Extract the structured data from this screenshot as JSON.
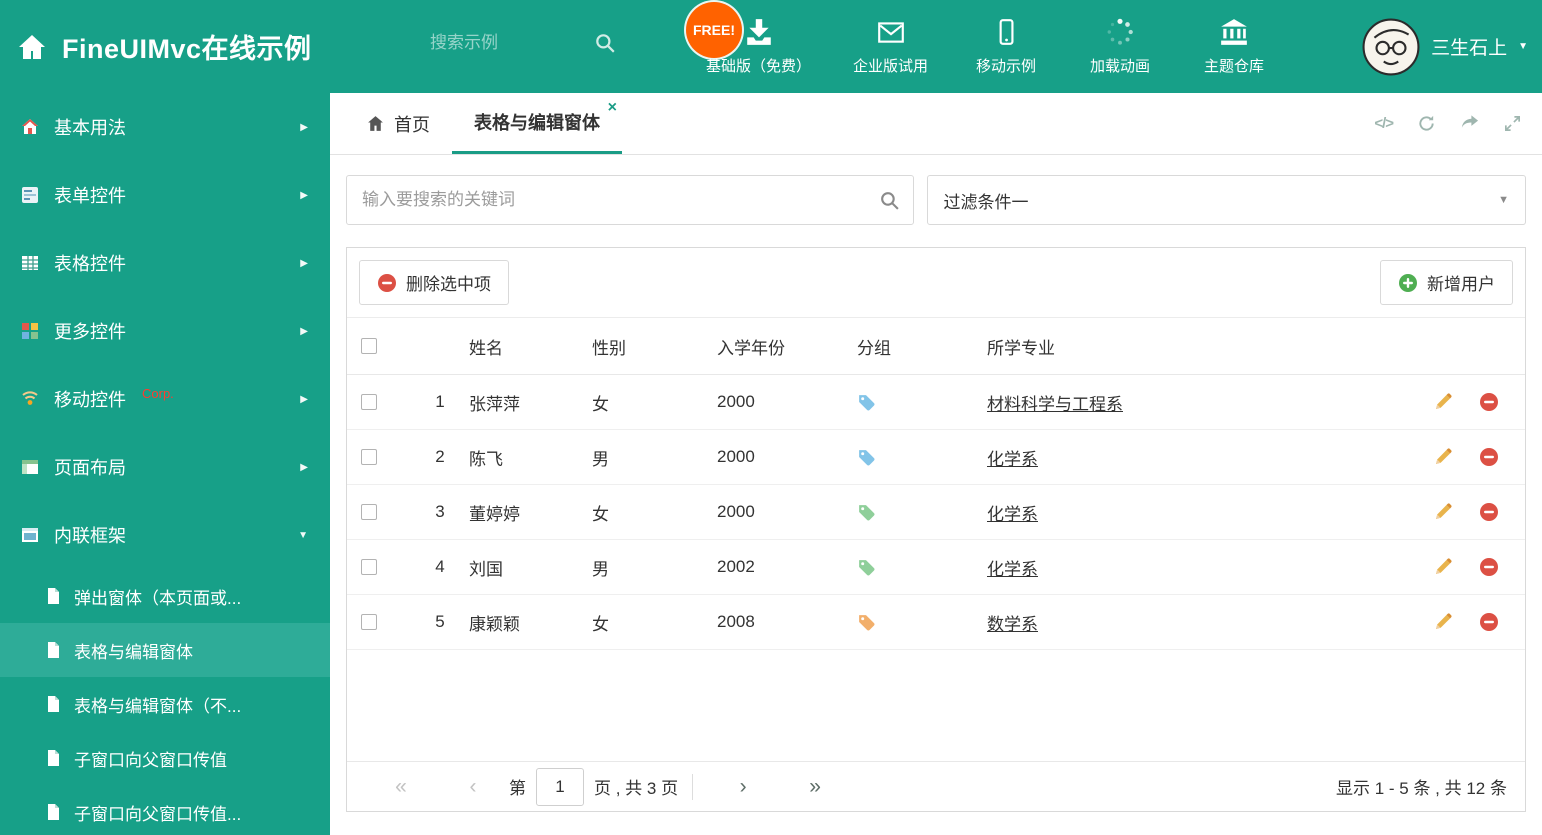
{
  "colors": {
    "theme_green": "#17A088",
    "selected_green": "#2EAC98",
    "accent": "#1A9C86",
    "free_badge": "#FF6200",
    "delete_red": "#DC5044",
    "add_green": "#4FAE52",
    "pencil_yellow": "#E9B44C",
    "link": "#333333",
    "corp_red": "#FF3B30"
  },
  "header": {
    "title": "FineUIMvc在线示例",
    "search_placeholder": "搜索示例",
    "free_badge": "FREE!",
    "nav": [
      {
        "label": "基础版（免费）",
        "icon": "download-icon"
      },
      {
        "label": "企业版试用",
        "icon": "envelope-icon"
      },
      {
        "label": "移动示例",
        "icon": "mobile-icon"
      },
      {
        "label": "加载动画",
        "icon": "spinner-icon"
      },
      {
        "label": "主题仓库",
        "icon": "bank-icon"
      }
    ],
    "user_name": "三生石上"
  },
  "sidebar": {
    "items": [
      {
        "label": "基本用法"
      },
      {
        "label": "表单控件"
      },
      {
        "label": "表格控件"
      },
      {
        "label": "更多控件"
      },
      {
        "label": "移动控件",
        "badge": "Corp."
      },
      {
        "label": "页面布局"
      },
      {
        "label": "内联框架"
      }
    ],
    "subitems": [
      {
        "label": "弹出窗体（本页面或..."
      },
      {
        "label": "表格与编辑窗体"
      },
      {
        "label": "表格与编辑窗体（不..."
      },
      {
        "label": "子窗口向父窗口传值"
      },
      {
        "label": "子窗口向父窗口传值..."
      }
    ]
  },
  "tabs": {
    "home": "首页",
    "active": "表格与编辑窗体"
  },
  "filter": {
    "search_placeholder": "输入要搜索的关键词",
    "dropdown_value": "过滤条件一"
  },
  "toolbar": {
    "delete_label": "删除选中项",
    "add_label": "新增用户"
  },
  "table": {
    "headers": {
      "name": "姓名",
      "gender": "性别",
      "year": "入学年份",
      "group": "分组",
      "major": "所学专业"
    },
    "rows": [
      {
        "index": "1",
        "name": "张萍萍",
        "gender": "女",
        "year": "2000",
        "tag_color": "#82C4E8",
        "major": "材料科学与工程系"
      },
      {
        "index": "2",
        "name": "陈飞",
        "gender": "男",
        "year": "2000",
        "tag_color": "#82C4E8",
        "major": "化学系"
      },
      {
        "index": "3",
        "name": "董婷婷",
        "gender": "女",
        "year": "2000",
        "tag_color": "#8FCF9A",
        "major": "化学系"
      },
      {
        "index": "4",
        "name": "刘国",
        "gender": "男",
        "year": "2002",
        "tag_color": "#8FCF9A",
        "major": "化学系"
      },
      {
        "index": "5",
        "name": "康颖颖",
        "gender": "女",
        "year": "2008",
        "tag_color": "#F2AF6B",
        "major": "数学系"
      }
    ]
  },
  "pagination": {
    "label_page": "第",
    "current_page": "1",
    "label_total": "页 , 共 3 页",
    "summary": "显示 1 - 5 条 , 共 12 条"
  }
}
